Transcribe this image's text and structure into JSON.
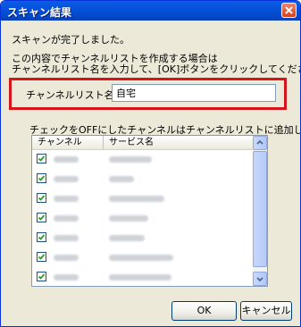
{
  "window": {
    "title": "スキャン結果"
  },
  "message": {
    "line1": "スキャンが完了しました。",
    "line2": "この内容でチャンネルリストを作成する場合は",
    "line3": "チャンネルリスト名を入力して、[OK]ボタンをクリックしてください。"
  },
  "name_field": {
    "label": "チャンネルリスト名(N):",
    "value": "自宅"
  },
  "list_note": "チェックをOFFにしたチャンネルはチャンネルリストに追加しません。",
  "listview": {
    "columns": [
      "チャンネル",
      "サービス名"
    ],
    "row_count": 7
  },
  "buttons": {
    "ok": "OK",
    "cancel": "キャンセル"
  },
  "colors": {
    "highlight_border": "#d6151a",
    "titlebar": "#0653d9"
  }
}
